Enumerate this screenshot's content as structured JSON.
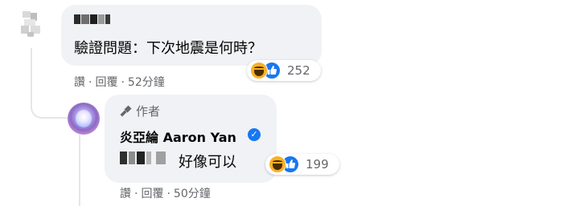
{
  "comment": {
    "text": "驗證問題：下次地震是何時？",
    "reactions": {
      "icons": [
        "haha-icon",
        "like-icon"
      ],
      "count": "252"
    },
    "actions": {
      "like": "讚",
      "reply": "回覆",
      "time": "52分鐘"
    }
  },
  "reply": {
    "badge": "作者",
    "author": "炎亞綸 Aaron Yan",
    "text": "好像可以",
    "reactions": {
      "icons": [
        "haha-icon",
        "like-icon"
      ],
      "count": "199"
    },
    "actions": {
      "like": "讚",
      "reply": "回覆",
      "time": "50分鐘"
    }
  },
  "colors": {
    "bubble": "#f0f2f5",
    "muted_text": "#65676b",
    "verified": "#1877f2",
    "haha": "#f7b125",
    "like": "#1877f2"
  }
}
